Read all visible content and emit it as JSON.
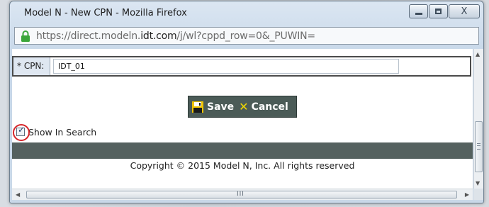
{
  "window": {
    "title": "Model N - New CPN - Mozilla Firefox",
    "minimize_label": "",
    "close_glyph": "X"
  },
  "address_bar": {
    "url_prefix": "https://direct.modeln.",
    "url_domain": "idt.com",
    "url_suffix": "/j/wl?cppd_row=0&_PUWIN=",
    "secure_icon": "lock-icon",
    "secure_color": "#3aa63a"
  },
  "form": {
    "cpn_label": "* CPN:",
    "cpn_value": "IDT_01"
  },
  "actions": {
    "save_label": "Save",
    "cancel_label": "Cancel",
    "cancel_icon": "✕",
    "bar_color": "#4b5b57"
  },
  "options": {
    "show_in_search_label": "Show In Search",
    "show_in_search_checked": true,
    "highlight_color": "#d6252a"
  },
  "footer": {
    "copyright": "Copyright © 2015 Model N, Inc. All rights reserved"
  },
  "scrollbars": {
    "h_grip": "III"
  }
}
